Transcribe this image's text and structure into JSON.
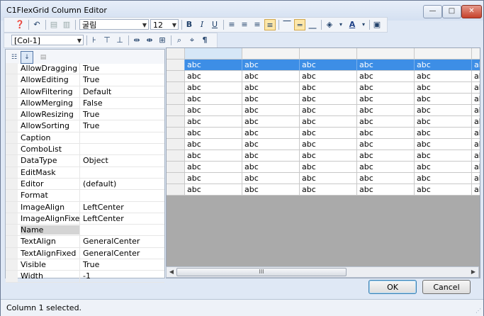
{
  "window": {
    "title": "C1FlexGrid Column Editor",
    "buttons": {
      "minimize": "—",
      "maximize": "□",
      "close": "✕"
    }
  },
  "toolbar": {
    "font_name": "굴림",
    "font_size": "12",
    "bold": "B",
    "italic": "I",
    "underline": "U",
    "pilcrow": "¶"
  },
  "column_selector": {
    "value": "[Col-1]"
  },
  "properties": [
    {
      "name": "AllowDragging",
      "value": "True"
    },
    {
      "name": "AllowEditing",
      "value": "True"
    },
    {
      "name": "AllowFiltering",
      "value": "Default"
    },
    {
      "name": "AllowMerging",
      "value": "False"
    },
    {
      "name": "AllowResizing",
      "value": "True"
    },
    {
      "name": "AllowSorting",
      "value": "True"
    },
    {
      "name": "Caption",
      "value": ""
    },
    {
      "name": "ComboList",
      "value": ""
    },
    {
      "name": "DataType",
      "value": "Object"
    },
    {
      "name": "EditMask",
      "value": ""
    },
    {
      "name": "Editor",
      "value": "(default)"
    },
    {
      "name": "Format",
      "value": ""
    },
    {
      "name": "ImageAlign",
      "value": "LeftCenter"
    },
    {
      "name": "ImageAlignFixed",
      "value": "LeftCenter"
    },
    {
      "name": "Name",
      "value": ""
    },
    {
      "name": "TextAlign",
      "value": "GeneralCenter"
    },
    {
      "name": "TextAlignFixed",
      "value": "GeneralCenter"
    },
    {
      "name": "Visible",
      "value": "True"
    },
    {
      "name": "Width",
      "value": "-1"
    }
  ],
  "grid": {
    "cell_text": "abc",
    "row_count": 12,
    "visible_columns": 6,
    "selected_row": 0
  },
  "buttons": {
    "ok": "OK",
    "cancel": "Cancel"
  },
  "status": {
    "text": "Column 1 selected."
  },
  "scrollbar": {
    "thumb_grip": "III",
    "left": "◀",
    "right": "▶"
  }
}
